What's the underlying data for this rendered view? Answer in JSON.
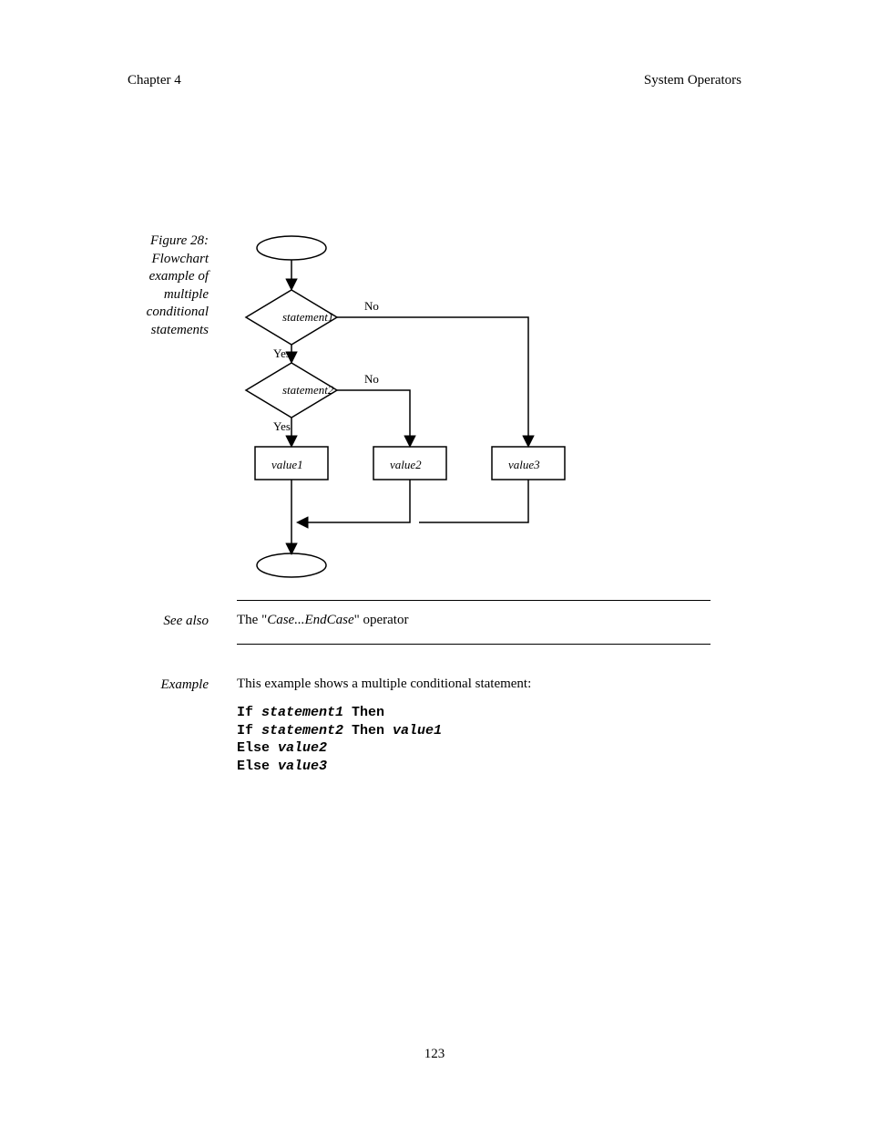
{
  "header": {
    "chapter_label": "Chapter 4",
    "chapter_title": "System Operators"
  },
  "margin": {
    "figure_caption": "Figure 28: Flowchart example of multiple conditional statements",
    "see_also_label": "See also",
    "example_label": "Example"
  },
  "flow": {
    "statement1": "statement1",
    "statement2": "statement2",
    "no": "No",
    "yes": "Yes",
    "value1": "value1",
    "value2": "value2",
    "value3": "value3"
  },
  "see_also": {
    "prefix": "The \"",
    "em": "Case...EndCase",
    "suffix": "\" operator"
  },
  "example_intro": "This example shows a multiple conditional statement:",
  "code": {
    "l1a": "If ",
    "l1b": "statement1",
    "l1c": " Then",
    "l2a": "If ",
    "l2b": "statement2",
    "l2c": " Then ",
    "l2d": "value1",
    "l3a": "Else ",
    "l3b": "value2",
    "l4a": "Else ",
    "l4b": "value3"
  },
  "page_number": "123"
}
